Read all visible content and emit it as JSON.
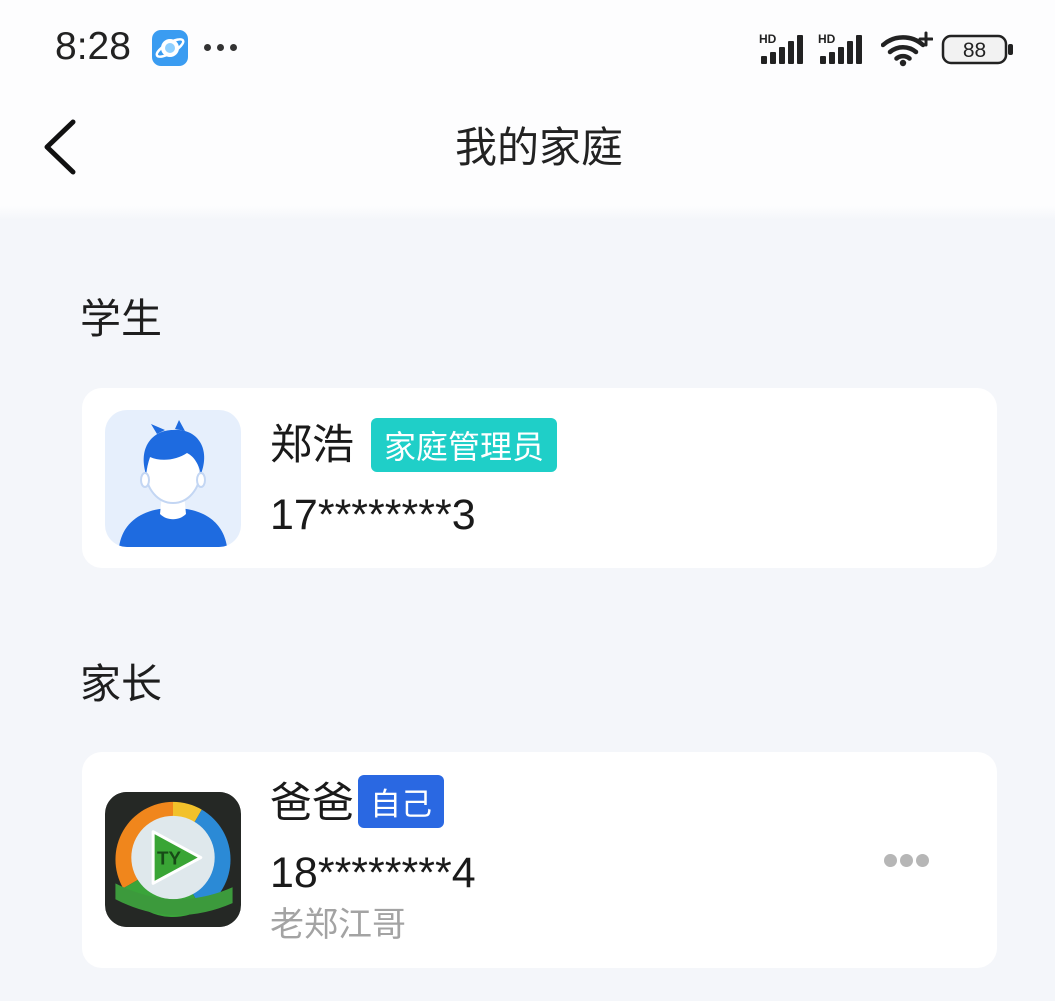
{
  "status_bar": {
    "time": "8:28",
    "signal_labels": [
      "HD",
      "HD"
    ],
    "battery": "88",
    "icons": [
      "app-notification-icon",
      "more-notifications-icon",
      "signal-icon",
      "signal-icon",
      "wifi-icon",
      "battery-icon"
    ]
  },
  "header": {
    "title": "我的家庭",
    "back_icon": "chevron-left-icon"
  },
  "sections": [
    {
      "title": "学生",
      "members": [
        {
          "name": "郑浩",
          "badge": "家庭管理员",
          "phone": "17********3",
          "avatar_icon": "default-user-avatar-icon"
        }
      ]
    },
    {
      "title": "家长",
      "members": [
        {
          "name": "爸爸",
          "badge": "自己",
          "phone": "18********4",
          "nickname": "老郑江哥",
          "avatar_logo_text": "TY",
          "more_icon": "more-horizontal-icon"
        }
      ]
    }
  ],
  "colors": {
    "page_background": "#f4f6fa",
    "card_background": "#ffffff",
    "badge_admin": "#1fcfc8",
    "badge_self": "#2a68e2",
    "secondary_text": "#a3a3a3"
  }
}
